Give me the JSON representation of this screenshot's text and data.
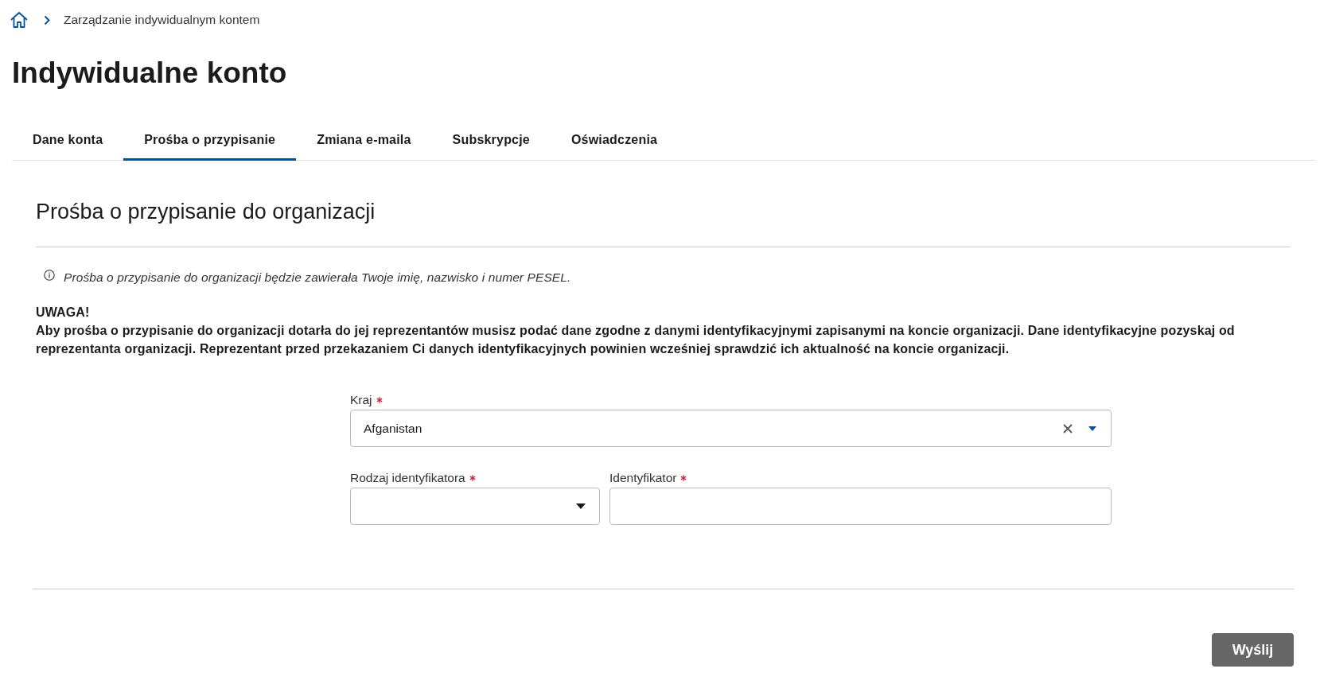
{
  "breadcrumb": {
    "current": "Zarządzanie indywidualnym kontem"
  },
  "page_title": "Indywidualne konto",
  "tabs": [
    {
      "label": "Dane konta",
      "selected": false
    },
    {
      "label": "Prośba o przypisanie",
      "selected": true
    },
    {
      "label": "Zmiana e-maila",
      "selected": false
    },
    {
      "label": "Subskrypcje",
      "selected": false
    },
    {
      "label": "Oświadczenia",
      "selected": false
    }
  ],
  "section": {
    "title": "Prośba o przypisanie do organizacji",
    "info": "Prośba o przypisanie do organizacji będzie zawierała Twoje imię, nazwisko i numer PESEL.",
    "warning": {
      "title": "UWAGA!",
      "text": "Aby prośba o przypisanie do organizacji dotarła do jej reprezentantów musisz podać dane zgodne z danymi identyfikacyjnymi zapisanymi na koncie organizacji. Dane identyfikacyjne pozyskaj od reprezentanta organizacji. Reprezentant przed przekazaniem Ci danych identyfikacyjnych powinien wcześniej sprawdzić ich aktualność na koncie organizacji."
    }
  },
  "form": {
    "rows": [
      {
        "fields": [
          {
            "kind": "combobox",
            "label": "Kraj",
            "required": true,
            "value": "Afganistan"
          }
        ]
      },
      {
        "fields": [
          {
            "kind": "select",
            "label": "Rodzaj identyfikatora",
            "required": true
          },
          {
            "kind": "text",
            "label": "Identyfikator",
            "required": true
          }
        ]
      }
    ]
  },
  "submit": {
    "label": "Wyślij",
    "disabled": true
  }
}
